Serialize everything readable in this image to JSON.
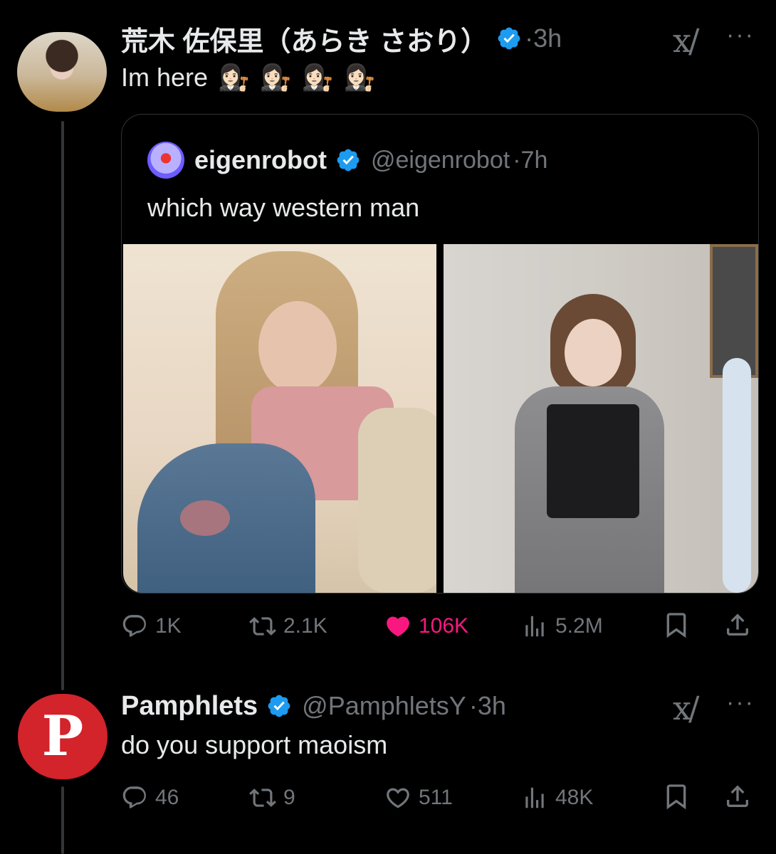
{
  "tweet1": {
    "display_name": "荒木 佐保里（あらき さおり）",
    "time": "3h",
    "text": "Im here",
    "emojis": [
      "👩🏻‍⚖️",
      "👩🏻‍⚖️",
      "👩🏻‍⚖️",
      "👩🏻‍⚖️"
    ],
    "quote": {
      "display_name": "eigenrobot",
      "handle": "@eigenrobot",
      "time": "7h",
      "text": "which way western man"
    },
    "stats": {
      "replies": "1K",
      "reposts": "2.1K",
      "likes": "106K",
      "views": "5.2M"
    }
  },
  "tweet2": {
    "display_name": "Pamphlets",
    "handle": "@PamphletsY",
    "time": "3h",
    "text": "do you support maoism",
    "avatar_letter": "P",
    "stats": {
      "replies": "46",
      "reposts": "9",
      "likes": "511",
      "views": "48K"
    }
  },
  "separator": "·",
  "colors": {
    "background": "#000000",
    "text": "#e7e9ea",
    "muted": "#71767b",
    "verified": "#1d9bf0",
    "like_active": "#f91880",
    "pamphlets_red": "#d3232b"
  },
  "icons": [
    "verified-badge-icon",
    "grok-icon",
    "more-icon",
    "reply-icon",
    "repost-icon",
    "like-icon",
    "views-icon",
    "bookmark-icon",
    "share-icon"
  ]
}
